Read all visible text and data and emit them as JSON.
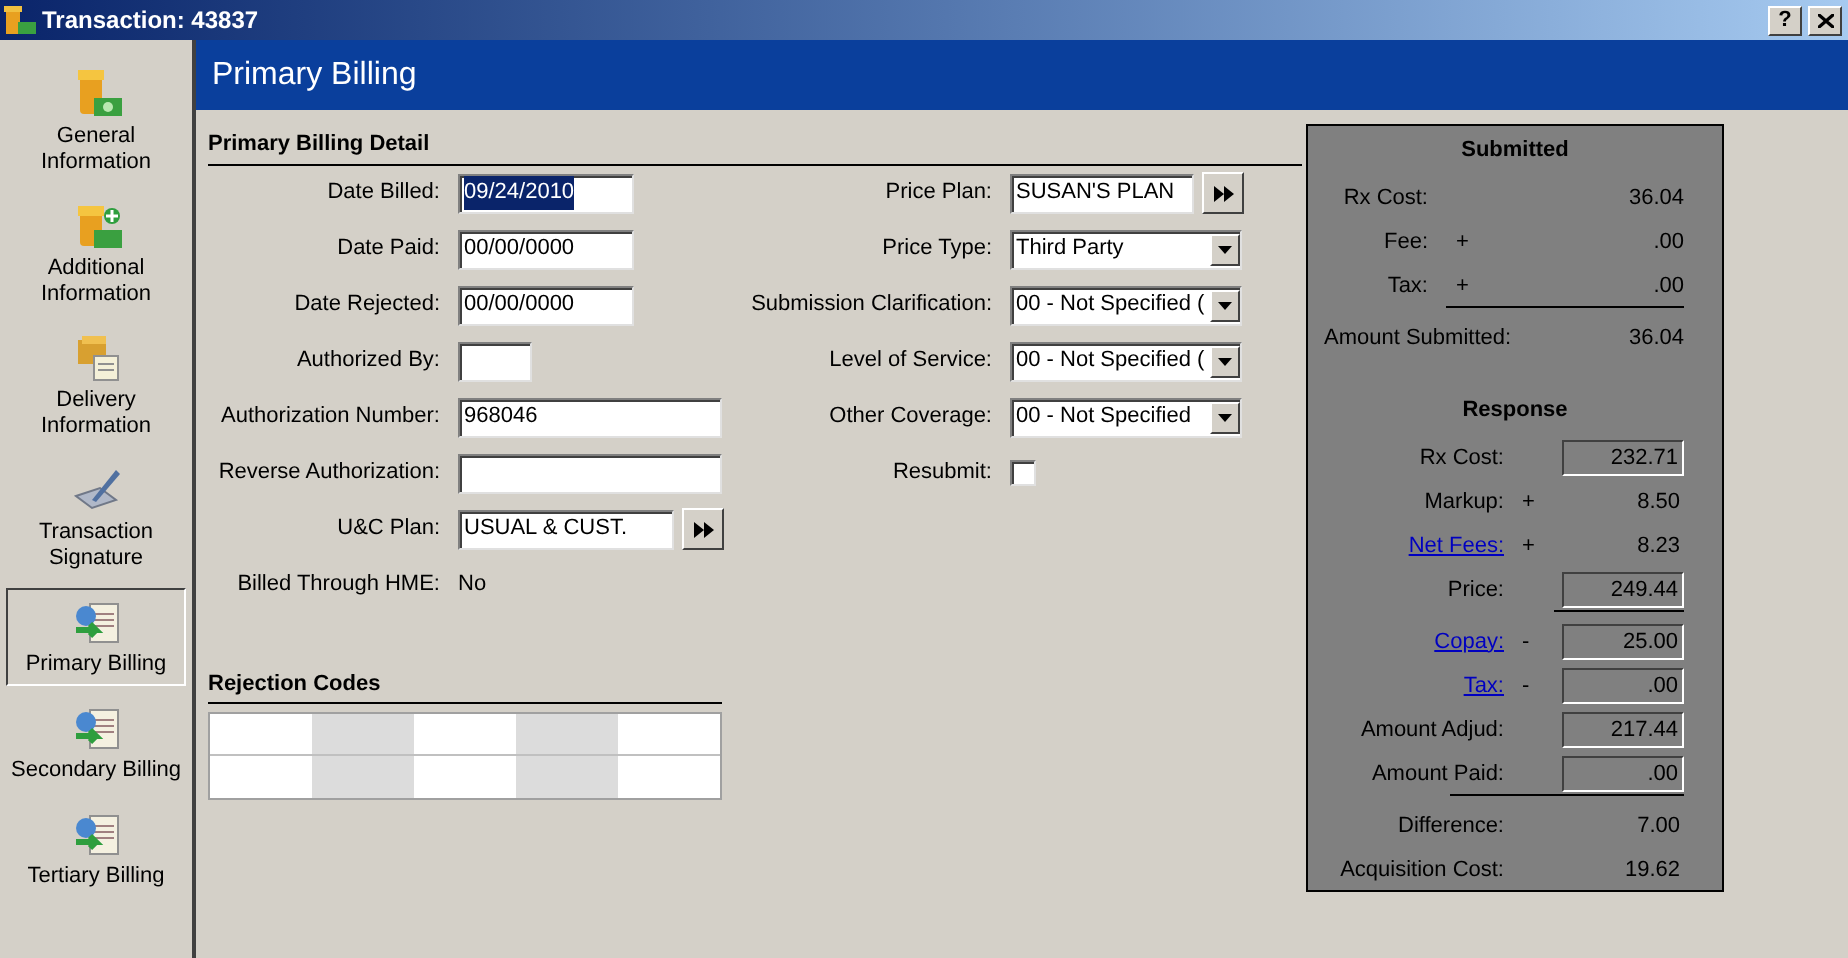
{
  "window": {
    "title": "Transaction: 43837",
    "help_button": "?"
  },
  "nav": [
    {
      "label": "General Information",
      "selected": false
    },
    {
      "label": "Additional Information",
      "selected": false
    },
    {
      "label": "Delivery Information",
      "selected": false
    },
    {
      "label": "Transaction Signature",
      "selected": false
    },
    {
      "label": "Primary Billing",
      "selected": true
    },
    {
      "label": "Secondary Billing",
      "selected": false
    },
    {
      "label": "Tertiary Billing",
      "selected": false
    }
  ],
  "header": "Primary Billing",
  "detail": {
    "title": "Primary Billing Detail",
    "left_fields": [
      {
        "label": "Date Billed:",
        "kind": "date",
        "value": "09/24/2010",
        "highlighted": true
      },
      {
        "label": "Date Paid:",
        "kind": "date",
        "value": "00/00/0000"
      },
      {
        "label": "Date Rejected:",
        "kind": "date",
        "value": "00/00/0000"
      },
      {
        "label": "Authorized By:",
        "kind": "initials"
      },
      {
        "label": "Authorization Number:",
        "kind": "text",
        "value": "968046"
      },
      {
        "label": "Reverse Authorization:",
        "kind": "text"
      },
      {
        "label": "U&C Plan:",
        "kind": "lookup",
        "value": "USUAL & CUST."
      },
      {
        "label": "Billed Through HME:",
        "kind": "plain",
        "value": "No"
      }
    ],
    "right_fields": [
      {
        "label": "Price Plan:",
        "kind": "lookup",
        "value": "SUSAN'S PLAN"
      },
      {
        "label": "Price Type:",
        "kind": "select",
        "value": "Third Party"
      },
      {
        "label": "Submission Clarification:",
        "kind": "select",
        "value": "00 - Not Specified ("
      },
      {
        "label": "Level of Service:",
        "kind": "select",
        "value": "00 - Not Specified ("
      },
      {
        "label": "Other Coverage:",
        "kind": "select",
        "value": "00 - Not Specified"
      },
      {
        "label": "Resubmit:",
        "kind": "checkbox",
        "checked": false
      }
    ]
  },
  "rejection_codes": {
    "title": "Rejection Codes"
  },
  "summary": {
    "submitted_title": "Submitted",
    "submitted": [
      {
        "label": "Rx Cost:",
        "value": "36.04",
        "kind": "plain",
        "rule_after": false
      },
      {
        "label": "Fee:",
        "op": "+",
        "value": ".00",
        "kind": "plain",
        "rule_after": false
      },
      {
        "label": "Tax:",
        "op": "+",
        "value": ".00",
        "kind": "plain",
        "rule_after": true
      },
      {
        "label": "Amount Submitted:",
        "value": "36.04",
        "kind": "total",
        "rule_after": false
      }
    ],
    "response_title": "Response",
    "response": [
      {
        "label": "Rx Cost:",
        "value": "232.71",
        "kind": "boxed",
        "link": false,
        "rule_after": false
      },
      {
        "label": "Markup:",
        "op": "+",
        "value": "8.50",
        "kind": "plain",
        "link": false,
        "rule_after": false
      },
      {
        "label": "Net Fees:",
        "op": "+",
        "value": "8.23",
        "kind": "plain",
        "link": true,
        "rule_after": false
      },
      {
        "label": "Price:",
        "value": "249.44",
        "kind": "boxed",
        "link": false,
        "rule_after": true
      },
      {
        "label": "Copay:",
        "op": "-",
        "value": "25.00",
        "kind": "boxed",
        "link": true,
        "rule_after": false
      },
      {
        "label": "Tax:",
        "op": "-",
        "value": ".00",
        "kind": "boxed",
        "link": true,
        "rule_after": false
      },
      {
        "label": "Amount Adjud:",
        "value": "217.44",
        "kind": "boxed",
        "link": false,
        "rule_after": false
      },
      {
        "label": "Amount Paid:",
        "value": ".00",
        "kind": "boxed",
        "link": false,
        "rule_after": true
      },
      {
        "label": "Difference:",
        "value": "7.00",
        "kind": "plain",
        "link": false,
        "rule_after": false
      },
      {
        "label": "Acquisition Cost:",
        "value": "19.62",
        "kind": "plain",
        "link": false,
        "rule_after": false
      }
    ]
  }
}
